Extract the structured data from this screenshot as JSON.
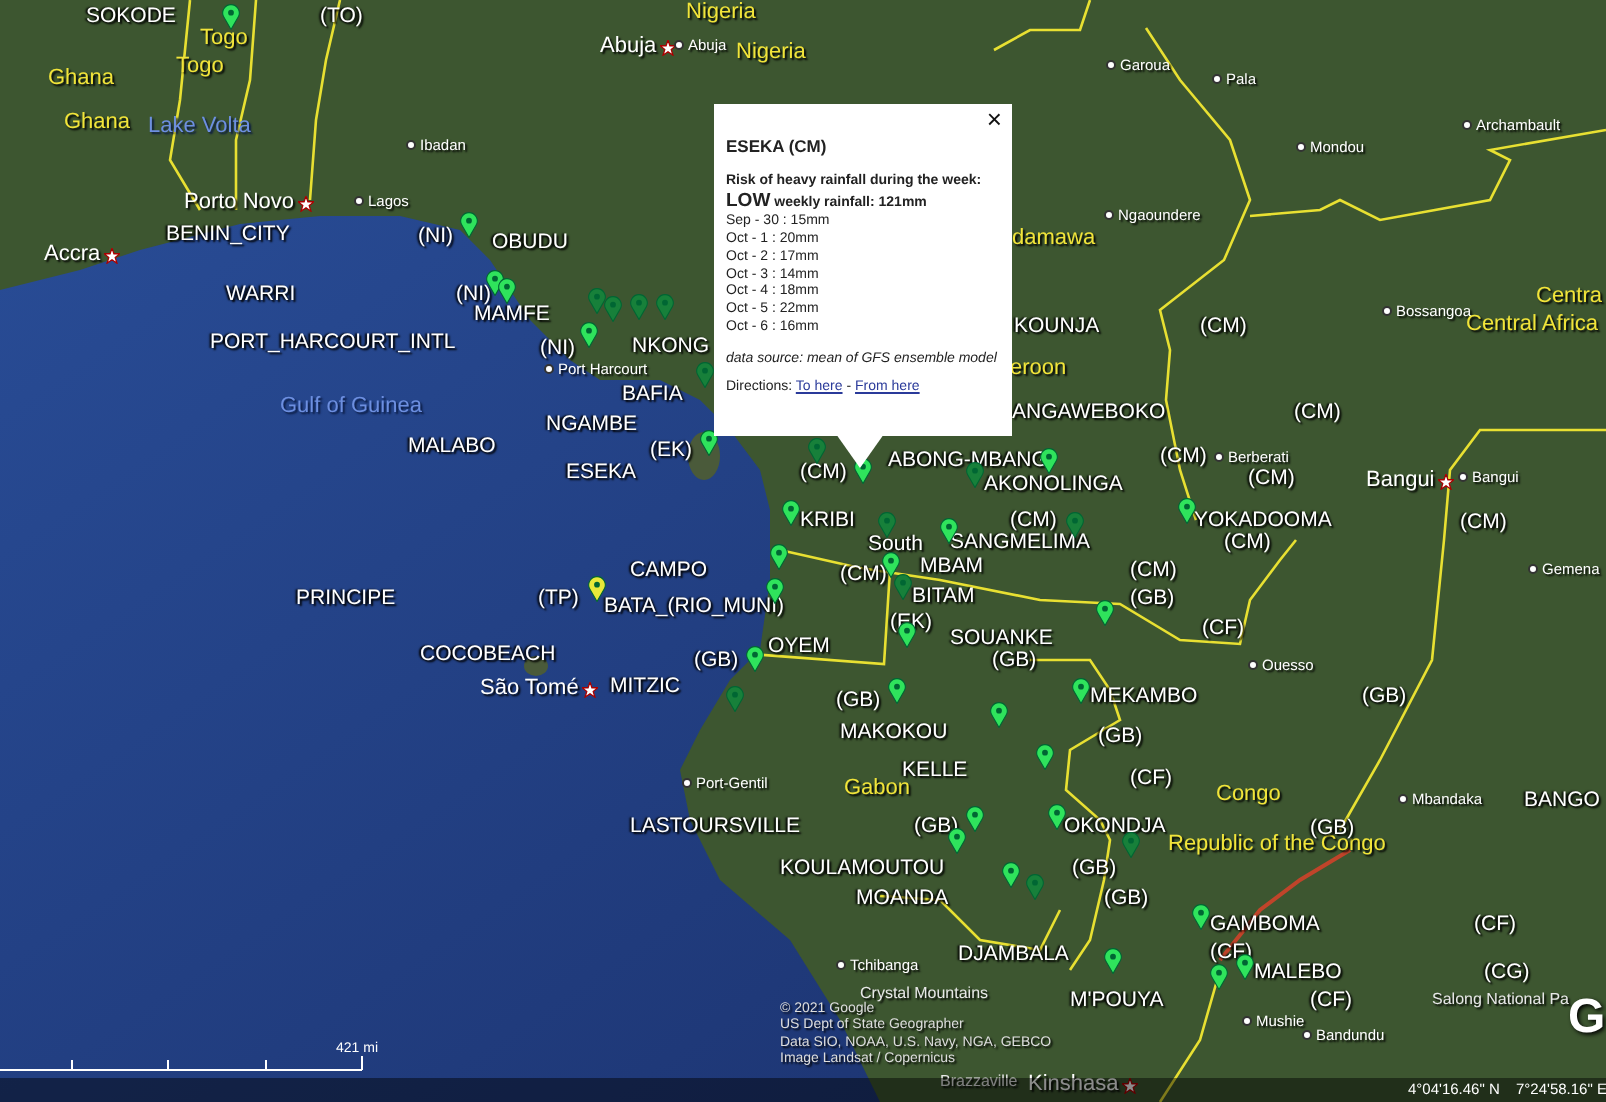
{
  "popup": {
    "close": "×",
    "title": "ESEKA (CM)",
    "risk_heading": "Risk of heavy rainfall during the week:",
    "risk_level": "LOW",
    "weekly_rainfall": "weekly rainfall: 121mm",
    "daily": [
      "Sep - 30 : 15mm",
      "Oct - 1 : 20mm",
      "Oct - 2 : 17mm",
      "Oct - 3 : 14mm",
      "Oct - 4 : 18mm",
      "Oct - 5 : 22mm",
      "Oct - 6 : 16mm"
    ],
    "source": "data source: mean of GFS ensemble model",
    "directions_label": "Directions:",
    "links": [
      "To here",
      "From here"
    ],
    "link_separator": "-"
  },
  "map_labels": [
    {
      "text": "SOKODE",
      "kind": "station"
    },
    {
      "text": "(TO)",
      "kind": "station"
    },
    {
      "text": "Nigeria",
      "kind": "region"
    },
    {
      "text": "Nigeria",
      "kind": "region"
    },
    {
      "text": "Togo",
      "kind": "region"
    },
    {
      "text": "Togo",
      "kind": "region"
    },
    {
      "text": "Ghana",
      "kind": "region"
    },
    {
      "text": "Ghana",
      "kind": "region"
    },
    {
      "text": "Lake Volta",
      "kind": "water"
    },
    {
      "text": "Abuja",
      "kind": "capital"
    },
    {
      "text": "Abuja",
      "kind": "town"
    },
    {
      "text": "Ibadan",
      "kind": "town"
    },
    {
      "text": "Porto Novo",
      "kind": "capital"
    },
    {
      "text": "Lagos",
      "kind": "town"
    },
    {
      "text": "BENIN_CITY",
      "kind": "station"
    },
    {
      "text": "(NI)",
      "kind": "station"
    },
    {
      "text": "OBUDU",
      "kind": "station"
    },
    {
      "text": "Accra",
      "kind": "capital"
    },
    {
      "text": "WARRI",
      "kind": "station"
    },
    {
      "text": "(NI)",
      "kind": "station"
    },
    {
      "text": "MAMFE",
      "kind": "station"
    },
    {
      "text": "PORT_HARCOURT_INTL",
      "kind": "station"
    },
    {
      "text": "(NI)",
      "kind": "station"
    },
    {
      "text": "NKONG",
      "kind": "station"
    },
    {
      "text": "Port Harcourt",
      "kind": "town"
    },
    {
      "text": "BAFIA",
      "kind": "station"
    },
    {
      "text": "Gulf of Guinea",
      "kind": "water"
    },
    {
      "text": "NGAMBE",
      "kind": "station"
    },
    {
      "text": "MALABO",
      "kind": "station"
    },
    {
      "text": "(EK)",
      "kind": "station"
    },
    {
      "text": "ESEKA",
      "kind": "station"
    },
    {
      "text": "Garoua",
      "kind": "town"
    },
    {
      "text": "Pala",
      "kind": "town"
    },
    {
      "text": "Archambault",
      "kind": "town"
    },
    {
      "text": "Mondou",
      "kind": "town"
    },
    {
      "text": "Ngaoundere",
      "kind": "town"
    },
    {
      "text": "damawa",
      "kind": "region"
    },
    {
      "text": "Centra",
      "kind": "region"
    },
    {
      "text": "Bossangoa",
      "kind": "town"
    },
    {
      "text": "KOUNJA",
      "kind": "station"
    },
    {
      "text": "(CM)",
      "kind": "station"
    },
    {
      "text": "Central Africa",
      "kind": "region"
    },
    {
      "text": "eroon",
      "kind": "region"
    },
    {
      "text": "ANGAWEBOKO",
      "kind": "station"
    },
    {
      "text": "(CM)",
      "kind": "station"
    },
    {
      "text": "ABONG-MBANG",
      "kind": "station"
    },
    {
      "text": "(CM)",
      "kind": "station"
    },
    {
      "text": "Berberati",
      "kind": "town"
    },
    {
      "text": "(CM)",
      "kind": "station"
    },
    {
      "text": "AKONOLINGA",
      "kind": "station"
    },
    {
      "text": "(CM)",
      "kind": "station"
    },
    {
      "text": "Bangui",
      "kind": "capital"
    },
    {
      "text": "Bangui",
      "kind": "town"
    },
    {
      "text": "KRIBI",
      "kind": "station"
    },
    {
      "text": "(CM)",
      "kind": "station"
    },
    {
      "text": "YOKADOOMA",
      "kind": "station"
    },
    {
      "text": "(CM)",
      "kind": "station"
    },
    {
      "text": "South",
      "kind": "station"
    },
    {
      "text": "SANGMELIMA",
      "kind": "station"
    },
    {
      "text": "(CM)",
      "kind": "station"
    },
    {
      "text": "CAMPO",
      "kind": "station"
    },
    {
      "text": "(CM)",
      "kind": "station"
    },
    {
      "text": "MBAM",
      "kind": "station"
    },
    {
      "text": "(CM)",
      "kind": "station"
    },
    {
      "text": "Gemena",
      "kind": "town"
    },
    {
      "text": "PRINCIPE",
      "kind": "station"
    },
    {
      "text": "(TP)",
      "kind": "station"
    },
    {
      "text": "BATA_(RIO_MUNI)",
      "kind": "station"
    },
    {
      "text": "BITAM",
      "kind": "station"
    },
    {
      "text": "(GB)",
      "kind": "station"
    },
    {
      "text": "COCOBEACH",
      "kind": "station"
    },
    {
      "text": "(GB)",
      "kind": "station"
    },
    {
      "text": "OYEM",
      "kind": "station"
    },
    {
      "text": "(EK)",
      "kind": "station"
    },
    {
      "text": "SOUANKE",
      "kind": "station"
    },
    {
      "text": "(GB)",
      "kind": "station"
    },
    {
      "text": "(CF)",
      "kind": "station"
    },
    {
      "text": "Ouesso",
      "kind": "town"
    },
    {
      "text": "São Tomé",
      "kind": "capital"
    },
    {
      "text": "MITZIC",
      "kind": "station"
    },
    {
      "text": "(GB)",
      "kind": "station"
    },
    {
      "text": "MEKAMBO",
      "kind": "station"
    },
    {
      "text": "(GB)",
      "kind": "station"
    },
    {
      "text": "MAKOKOU",
      "kind": "station"
    },
    {
      "text": "(GB)",
      "kind": "station"
    },
    {
      "text": "Port-Gentil",
      "kind": "town"
    },
    {
      "text": "Gabon",
      "kind": "region"
    },
    {
      "text": "KELLE",
      "kind": "station"
    },
    {
      "text": "(CF)",
      "kind": "station"
    },
    {
      "text": "Congo",
      "kind": "region"
    },
    {
      "text": "Mbandaka",
      "kind": "town"
    },
    {
      "text": "BANGO",
      "kind": "station"
    },
    {
      "text": "LASTOURSVILLE",
      "kind": "station"
    },
    {
      "text": "(GB)",
      "kind": "station"
    },
    {
      "text": "OKONDJA",
      "kind": "station"
    },
    {
      "text": "Republic of the Congo",
      "kind": "region"
    },
    {
      "text": "(GB)",
      "kind": "station"
    },
    {
      "text": "KOULAMOUTOU",
      "kind": "station"
    },
    {
      "text": "(GB)",
      "kind": "station"
    },
    {
      "text": "MOANDA",
      "kind": "station"
    },
    {
      "text": "(GB)",
      "kind": "station"
    },
    {
      "text": "GAMBOMA",
      "kind": "station"
    },
    {
      "text": "(CF)",
      "kind": "station"
    },
    {
      "text": "Tchibanga",
      "kind": "town"
    },
    {
      "text": "DJAMBALA",
      "kind": "station"
    },
    {
      "text": "(CF)",
      "kind": "station"
    },
    {
      "text": "MALEBO",
      "kind": "station"
    },
    {
      "text": "(CG)",
      "kind": "station"
    },
    {
      "text": "Crystal Mountains",
      "kind": "place"
    },
    {
      "text": "M'POUYA",
      "kind": "station"
    },
    {
      "text": "(CF)",
      "kind": "station"
    },
    {
      "text": "Salong National Pa",
      "kind": "place"
    },
    {
      "text": "Mushie",
      "kind": "town"
    },
    {
      "text": "Bandundu",
      "kind": "town"
    },
    {
      "text": "Brazzaville",
      "kind": "place"
    },
    {
      "text": "Kinshasa",
      "kind": "capital"
    }
  ],
  "markers": [
    {
      "color": "#2fe35c"
    },
    {
      "color": "#2fe35c"
    },
    {
      "color": "#2fe35c"
    },
    {
      "color": "#2fe35c"
    },
    {
      "color": "#2fe35c"
    },
    {
      "color": "#17803a"
    },
    {
      "color": "#17803a"
    },
    {
      "color": "#17803a"
    },
    {
      "color": "#17803a"
    },
    {
      "color": "#17803a"
    },
    {
      "color": "#2fe35c"
    },
    {
      "color": "#17803a"
    },
    {
      "color": "#2fe35c"
    },
    {
      "color": "#17803a"
    },
    {
      "color": "#2fe35c"
    },
    {
      "color": "#2fe35c"
    },
    {
      "color": "#17803a"
    },
    {
      "color": "#2fe35c"
    },
    {
      "color": "#17803a"
    },
    {
      "color": "#2fe35c"
    },
    {
      "color": "#2fe35c"
    },
    {
      "color": "#2fe35c"
    },
    {
      "color": "#2fe35c"
    },
    {
      "color": "#17803a"
    },
    {
      "color": "#2fe35c"
    },
    {
      "color": "#2fe35c"
    },
    {
      "color": "#2fe35c"
    },
    {
      "color": "#17803a"
    },
    {
      "color": "#2fe35c"
    },
    {
      "color": "#2fe35c"
    },
    {
      "color": "#2fe35c"
    },
    {
      "color": "#2fe35c"
    },
    {
      "color": "#2fe35c"
    },
    {
      "color": "#2fe35c"
    },
    {
      "color": "#2fe35c"
    },
    {
      "color": "#17803a"
    },
    {
      "color": "#2fe35c"
    },
    {
      "color": "#17803a"
    },
    {
      "color": "#2fe35c"
    },
    {
      "color": "#2fe35c"
    },
    {
      "color": "#2fe35c"
    },
    {
      "color": "#2fe35c"
    },
    {
      "color": "#e8e83a"
    }
  ],
  "scale": "421 mi",
  "attribution": [
    "© 2021 Google",
    "US Dept of State Geographer",
    "Data SIO, NOAA, U.S. Navy, NGA, GEBCO",
    "Image Landsat / Copernicus"
  ],
  "logo": "G",
  "status_bar": {
    "latitude": "4°04'16.46\" N",
    "longitude": "7°24'58.16\" E"
  }
}
